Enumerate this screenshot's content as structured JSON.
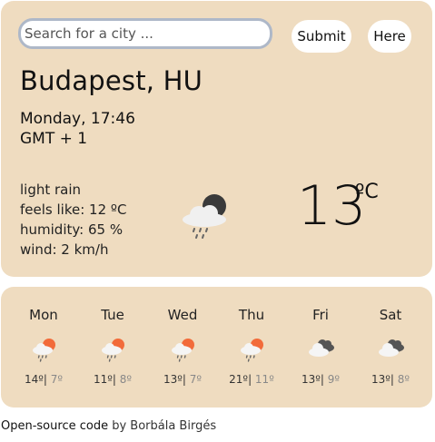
{
  "search": {
    "placeholder": "Search for a city ..."
  },
  "buttons": {
    "submit_label": "Submit",
    "here_label": "Here"
  },
  "current": {
    "city": "Budapest, HU",
    "datetime": "Monday, 17:46",
    "timezone": "GMT + 1",
    "description": "light rain",
    "feels_like": "feels like: 12 ºC",
    "humidity": "humidity: 65 %",
    "wind": "wind: 2 km/h",
    "temperature": "13",
    "unit": "ºC",
    "icon": "night-cloud-rain-icon"
  },
  "forecast": [
    {
      "day": "Mon",
      "max": "14º",
      "min": "7º",
      "icon": "cloud-rain-sun-icon"
    },
    {
      "day": "Tue",
      "max": "11º",
      "min": "8º",
      "icon": "cloud-rain-sun-icon"
    },
    {
      "day": "Wed",
      "max": "13º",
      "min": "7º",
      "icon": "cloud-rain-sun-icon"
    },
    {
      "day": "Thu",
      "max": "21º",
      "min": "11º",
      "icon": "cloud-rain-sun-icon"
    },
    {
      "day": "Fri",
      "max": "13º",
      "min": "9º",
      "icon": "cloudy-icon"
    },
    {
      "day": "Sat",
      "max": "13º",
      "min": "8º",
      "icon": "cloudy-icon"
    }
  ],
  "footer": {
    "link_text": "Open-source code",
    "byline": " by Borbála Birgés"
  },
  "colors": {
    "card_background": "#efdcc0",
    "sun": "#f26b3a",
    "cloud_dark": "#555555"
  }
}
